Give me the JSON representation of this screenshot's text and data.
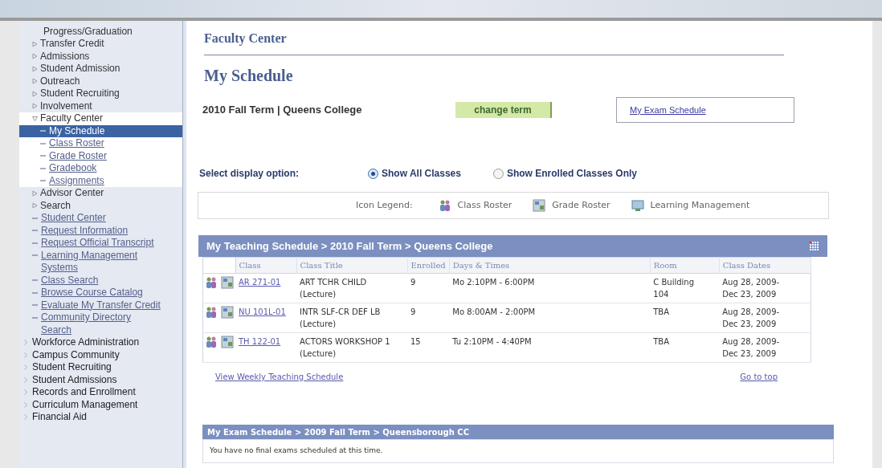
{
  "sidebar": {
    "items": [
      {
        "kind": "plain",
        "label": "Progress/Graduation"
      },
      {
        "kind": "folder",
        "label": "Transfer Credit",
        "expanded": false
      },
      {
        "kind": "folder",
        "label": "Admissions",
        "expanded": false
      },
      {
        "kind": "folder",
        "label": "Student Admission",
        "expanded": false
      },
      {
        "kind": "folder",
        "label": "Outreach",
        "expanded": false
      },
      {
        "kind": "folder",
        "label": "Student Recruiting",
        "expanded": false
      },
      {
        "kind": "folder",
        "label": "Involvement",
        "expanded": false
      },
      {
        "kind": "folder",
        "label": "Faculty Center",
        "expanded": true,
        "children": [
          {
            "label": "My Schedule",
            "selected": true
          },
          {
            "label": "Class Roster",
            "selected": false
          },
          {
            "label": "Grade Roster",
            "selected": false
          },
          {
            "label": "Gradebook",
            "selected": false
          },
          {
            "label": "Assignments",
            "selected": false
          }
        ]
      },
      {
        "kind": "folder",
        "label": "Advisor Center",
        "expanded": false
      },
      {
        "kind": "folder",
        "label": "Search",
        "expanded": false
      },
      {
        "kind": "link",
        "label": "Student Center"
      },
      {
        "kind": "link",
        "label": "Request Information"
      },
      {
        "kind": "link",
        "label": "Request Official Transcript"
      },
      {
        "kind": "link",
        "label": "Learning Management Systems"
      },
      {
        "kind": "link",
        "label": "Class Search"
      },
      {
        "kind": "link",
        "label": "Browse Course Catalog"
      },
      {
        "kind": "link",
        "label": "Evaluate My Transfer Credit"
      },
      {
        "kind": "link",
        "label": "Community Directory Search"
      },
      {
        "kind": "top",
        "label": "Workforce Administration"
      },
      {
        "kind": "top",
        "label": "Campus Community"
      },
      {
        "kind": "top",
        "label": "Student Recruiting"
      },
      {
        "kind": "top",
        "label": "Student Admissions"
      },
      {
        "kind": "top",
        "label": "Records and Enrollment"
      },
      {
        "kind": "top",
        "label": "Curriculum Management"
      },
      {
        "kind": "top",
        "label": "Financial Aid"
      }
    ]
  },
  "header": {
    "title": "Faculty Center",
    "subtitle": "My Schedule"
  },
  "term": {
    "label": "2010 Fall Term | Queens College",
    "button": "change term",
    "exam_link": "My Exam Schedule"
  },
  "display_option": {
    "label": "Select display option:",
    "options": [
      {
        "label": "Show All Classes",
        "selected": true
      },
      {
        "label": "Show Enrolled Classes Only",
        "selected": false
      }
    ]
  },
  "legend": {
    "label": "Icon Legend:",
    "items": [
      {
        "kind": "roster",
        "label": "Class Roster"
      },
      {
        "kind": "grade",
        "label": "Grade Roster"
      },
      {
        "kind": "learning",
        "label": "Learning Management"
      }
    ]
  },
  "teaching_schedule": {
    "title": "My Teaching Schedule > 2010 Fall Term > Queens College",
    "columns": [
      "Class",
      "Class Title",
      "Enrolled",
      "Days & Times",
      "Room",
      "Class Dates"
    ],
    "rows": [
      {
        "class": "AR 271-01",
        "title": "ART TCHR CHILD",
        "type": "(Lecture)",
        "enrolled": "9",
        "days_times": "Mo 2:10PM - 6:00PM",
        "room": "C Building 104",
        "dates": "Aug 28, 2009- Dec 23, 2009"
      },
      {
        "class": "NU 101L-01",
        "title": "INTR SLF-CR DEF LB",
        "type": "(Lecture)",
        "enrolled": "9",
        "days_times": "Mo 8:00AM - 2:00PM",
        "room": "TBA",
        "dates": "Aug 28, 2009- Dec 23, 2009"
      },
      {
        "class": "TH 122-01",
        "title": "ACTORS WORKSHOP 1",
        "type": "(Lecture)",
        "enrolled": "15",
        "days_times": "Tu 2:10PM - 4:40PM",
        "room": "TBA",
        "dates": "Aug 28, 2009- Dec 23, 2009"
      }
    ]
  },
  "links": {
    "weekly": "View Weekly Teaching Schedule",
    "top": "Go to top"
  },
  "exam_schedule": {
    "title": "My Exam Schedule > 2009 Fall Term > Queensborough CC",
    "message": "You have no final exams scheduled at this time."
  }
}
